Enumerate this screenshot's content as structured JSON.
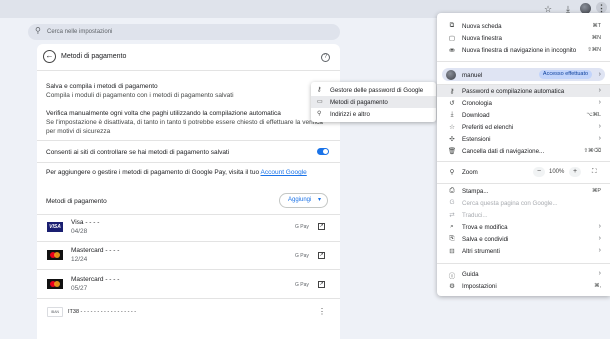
{
  "toolbar": {
    "icons": [
      "star-icon",
      "download-icon",
      "avatar",
      "menu-dots-icon"
    ]
  },
  "search": {
    "placeholder": "Cerca nelle impostazioni"
  },
  "settings": {
    "title": "Metodi di pagamento",
    "line1": "Salva e compila i metodi di pagamento",
    "line2": "Compila i moduli di pagamento con i metodi di pagamento salvati",
    "line3": "Verifica manualmente ogni volta che paghi utilizzando la compilazione automatica",
    "line4": "Se l'impostazione è disattivata, di tanto in tanto ti potrebbe essere chiesto di effettuare la verifica",
    "line5": "per motivi di sicurezza",
    "toggle_label": "Consenti ai siti di controllare se hai metodi di pagamento salvati",
    "toggle_on": true,
    "gpay_text": "Per aggiungere o gestire i metodi di pagamento di Google Pay, visita il tuo",
    "gpay_link": "Account Google",
    "methods_heading": "Metodi di pagamento",
    "add_label": "Aggiungi",
    "cards": [
      {
        "brand": "Visa",
        "name": "Visa - - - -",
        "expiry": "04/28",
        "source": "G Pay"
      },
      {
        "brand": "Mastercard",
        "name": "Mastercard - - - -",
        "expiry": "12/24",
        "source": "G Pay"
      },
      {
        "brand": "Mastercard",
        "name": "Mastercard - - - -",
        "expiry": "05/27",
        "source": "G Pay"
      }
    ],
    "iban": {
      "badge": "IBAN",
      "value": "IT38 - - - - - - - - - - - - - - - - -"
    }
  },
  "submenu": {
    "items": [
      {
        "icon": "key-icon",
        "label": "Gestore delle password di Google"
      },
      {
        "icon": "card-icon",
        "label": "Metodi di pagamento"
      },
      {
        "icon": "location-icon",
        "label": "Indirizzi e altro"
      }
    ]
  },
  "menu": {
    "new_tab": {
      "label": "Nuova scheda",
      "shortcut": "⌘T"
    },
    "new_window": {
      "label": "Nuova finestra",
      "shortcut": "⌘N"
    },
    "incognito": {
      "label": "Nuova finestra di navigazione in incognito",
      "shortcut": "⇧⌘N"
    },
    "profile": {
      "name": "manuel",
      "status": "Accesso effettuato"
    },
    "passwords": {
      "label": "Password e compilazione automatica"
    },
    "history": {
      "label": "Cronologia"
    },
    "downloads": {
      "label": "Download",
      "shortcut": "⌥⌘L"
    },
    "bookmarks": {
      "label": "Preferiti ed elenchi"
    },
    "extensions": {
      "label": "Estensioni"
    },
    "clear": {
      "label": "Cancella dati di navigazione...",
      "shortcut": "⇧⌘⌫"
    },
    "zoom": {
      "label": "Zoom",
      "minus": "−",
      "value": "100%",
      "plus": "+"
    },
    "print": {
      "label": "Stampa...",
      "shortcut": "⌘P"
    },
    "search_page": {
      "label": "Cerca questa pagina con Google..."
    },
    "translate": {
      "label": "Traduci..."
    },
    "find": {
      "label": "Trova e modifica"
    },
    "save_share": {
      "label": "Salva e condividi"
    },
    "more_tools": {
      "label": "Altri strumenti"
    },
    "guide": {
      "label": "Guida"
    },
    "settings": {
      "label": "Impostazioni",
      "shortcut": "⌘,"
    }
  }
}
